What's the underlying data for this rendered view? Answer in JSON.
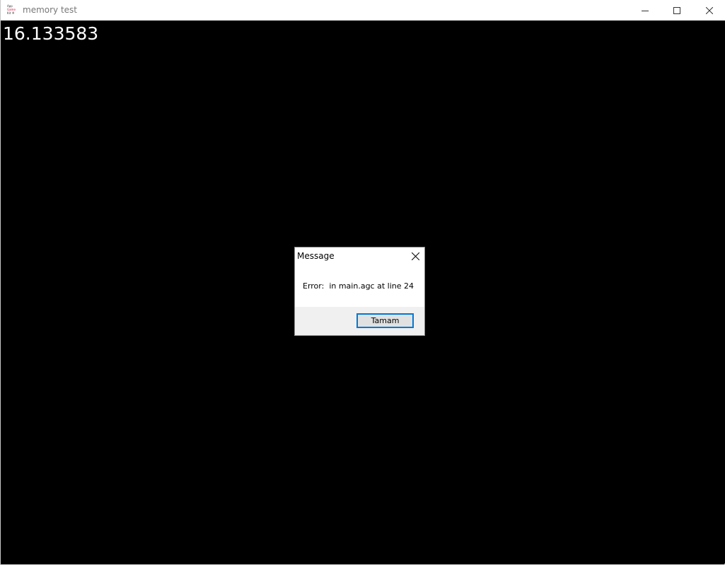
{
  "window": {
    "title": "memory test",
    "icon": "agk-app-icon",
    "icon_lines": [
      "App",
      "Game",
      "Kit ®"
    ],
    "controls": [
      "minimize-icon",
      "maximize-icon",
      "close-icon"
    ]
  },
  "canvas": {
    "readout": "16.133583",
    "background": "#000000"
  },
  "dialog": {
    "title": "Message",
    "message": "Error:  in main.agc at line 24",
    "ok_label": "Tamam",
    "accent": "#0078d7"
  }
}
